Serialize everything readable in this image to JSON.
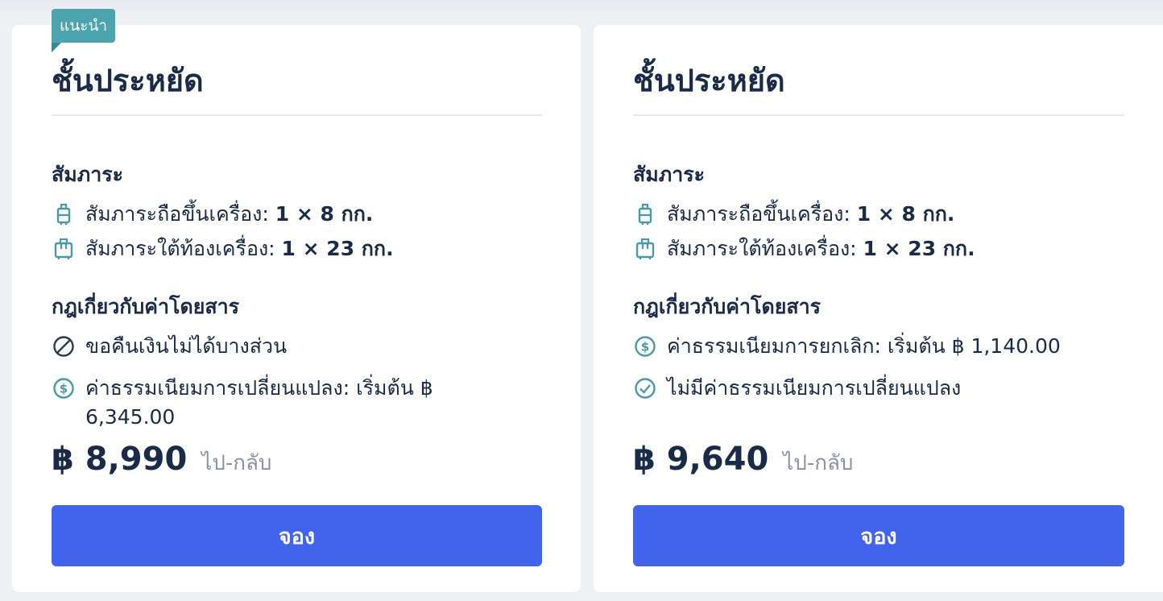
{
  "colors": {
    "accent": "#4263eb",
    "badge": "#4ba4ae",
    "icon": "#4a9aa5",
    "text": "#1a2b48",
    "muted": "#8a93a3"
  },
  "cards": [
    {
      "badge": "แนะนำ",
      "title": "ชั้นประหยัด",
      "baggage_heading": "สัมภาระ",
      "baggage": [
        {
          "icon": "carry-on-bag-icon",
          "label": "สัมภาระถือขึ้นเครื่อง: ",
          "value": "1 × 8 กก."
        },
        {
          "icon": "checked-bag-icon",
          "label": "สัมภาระใต้ท้องเครื่อง: ",
          "value": "1 × 23 กก."
        }
      ],
      "rules_heading": "กฎเกี่ยวกับค่าโดยสาร",
      "rules": [
        {
          "icon": "no-entry-icon",
          "text": "ขอคืนเงินไม่ได้บางส่วน"
        },
        {
          "icon": "dollar-circle-icon",
          "text": "ค่าธรรมเนียมการเปลี่ยนแปลง: เริ่มต้น ฿ 6,345.00"
        }
      ],
      "price": "฿ 8,990",
      "trip_type": "ไป-กลับ",
      "book_label": "จอง"
    },
    {
      "title": "ชั้นประหยัด",
      "baggage_heading": "สัมภาระ",
      "baggage": [
        {
          "icon": "carry-on-bag-icon",
          "label": "สัมภาระถือขึ้นเครื่อง: ",
          "value": "1 × 8 กก."
        },
        {
          "icon": "checked-bag-icon",
          "label": "สัมภาระใต้ท้องเครื่อง: ",
          "value": "1 × 23 กก."
        }
      ],
      "rules_heading": "กฎเกี่ยวกับค่าโดยสาร",
      "rules": [
        {
          "icon": "dollar-circle-icon",
          "text": "ค่าธรรมเนียมการยกเลิก: เริ่มต้น ฿ 1,140.00"
        },
        {
          "icon": "check-circle-icon",
          "text": "ไม่มีค่าธรรมเนียมการเปลี่ยนแปลง"
        }
      ],
      "price": "฿ 9,640",
      "trip_type": "ไป-กลับ",
      "book_label": "จอง"
    }
  ]
}
